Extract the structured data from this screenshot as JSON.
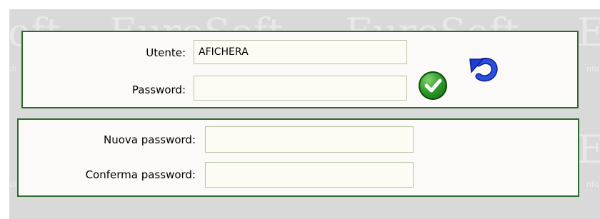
{
  "watermark": {
    "brand": "EuroSoft",
    "fragment_left": "oft",
    "fragment_right": "E",
    "small_left": "di",
    "small_right": "nfo"
  },
  "login": {
    "user_label": "Utente:",
    "user_value": "AFICHERA",
    "password_label": "Password:",
    "password_value": ""
  },
  "change_password": {
    "new_label": "Nuova password:",
    "new_value": "",
    "confirm_label": "Conferma password:",
    "confirm_value": ""
  },
  "icons": {
    "confirm": "check-icon",
    "undo": "undo-arrow-icon"
  },
  "colors": {
    "panel_border": "#2d6b2d",
    "confirm_green": "#2e9a2a",
    "undo_blue": "#1f3fd0",
    "background": "#d9d9d9"
  }
}
